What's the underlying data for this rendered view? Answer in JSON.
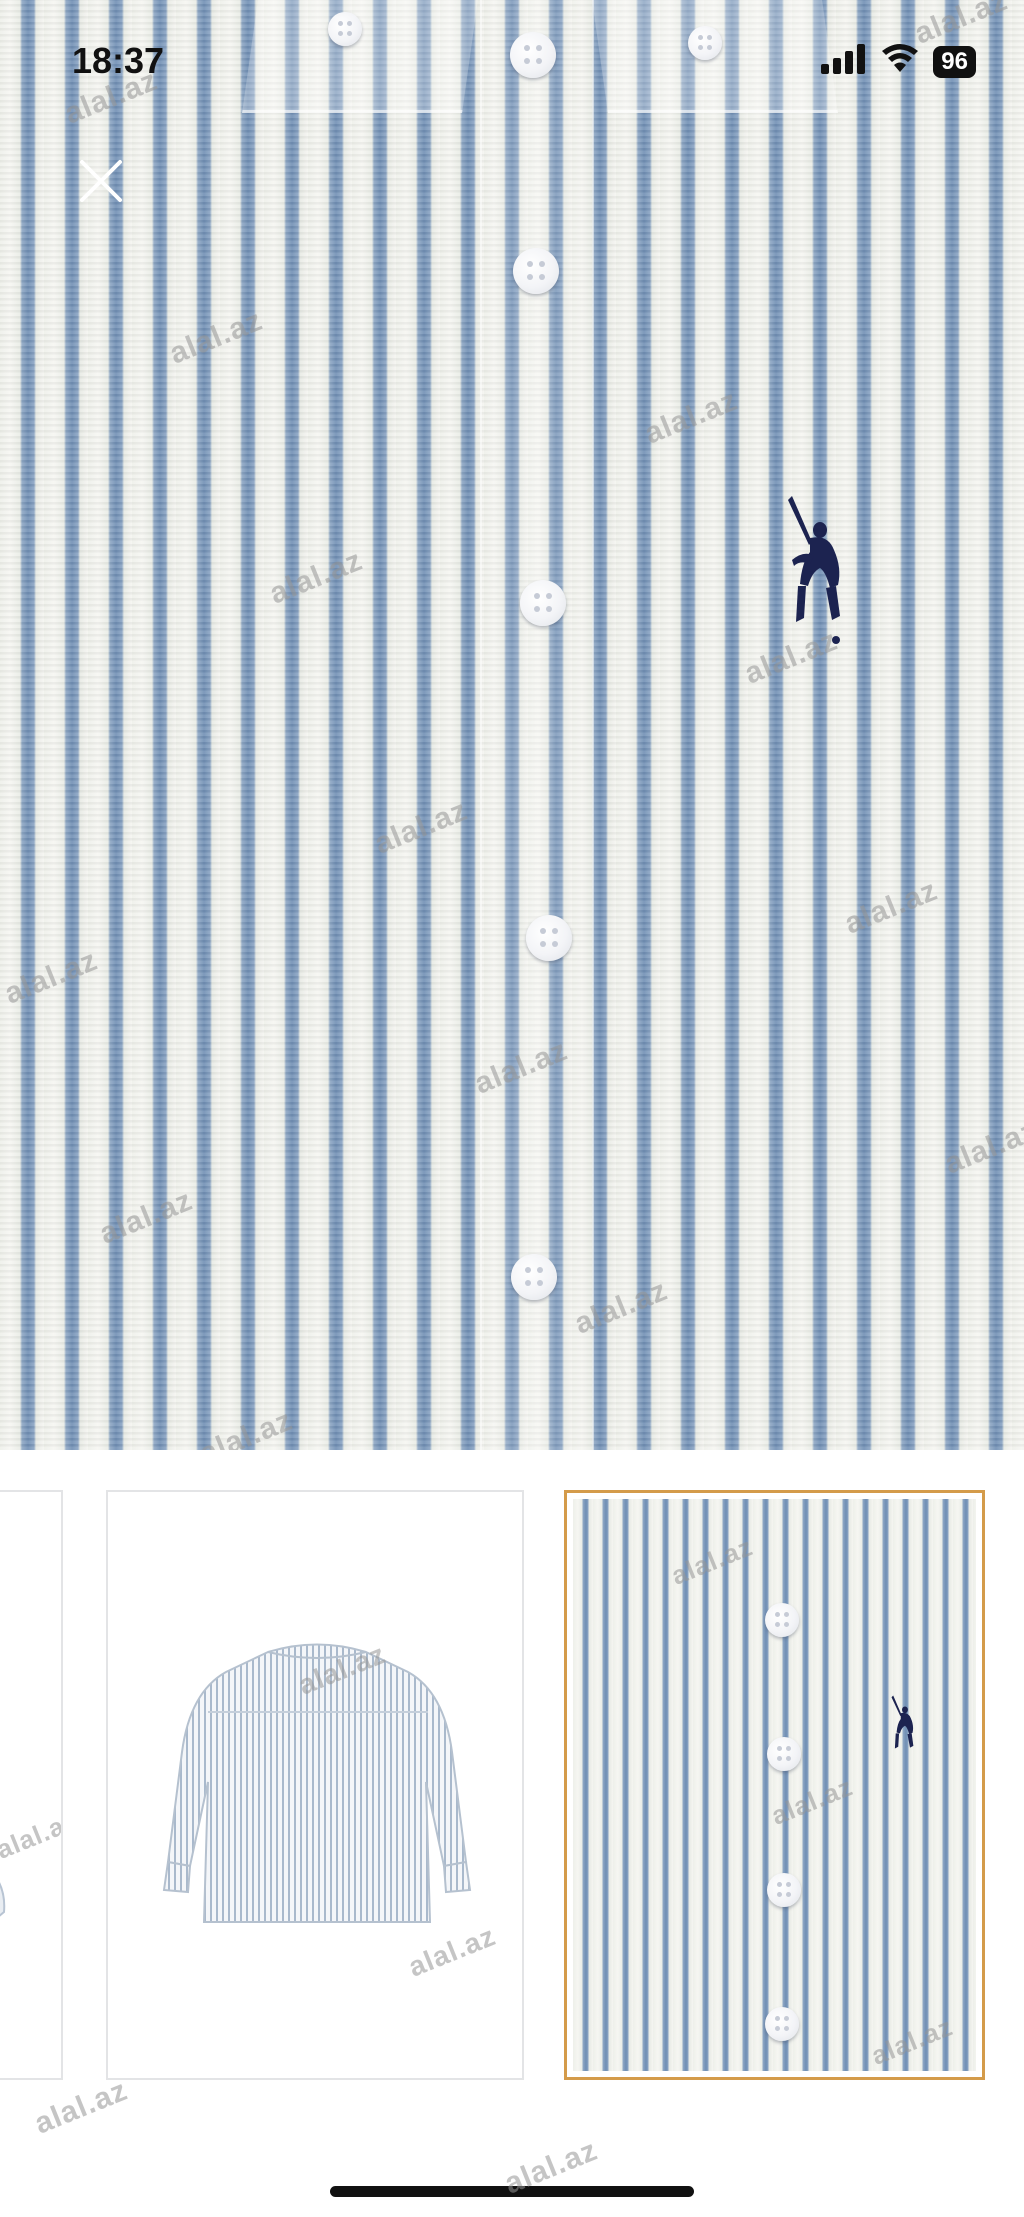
{
  "status_bar": {
    "time": "18:37",
    "battery": "96"
  },
  "viewer": {
    "close_icon": "close-icon",
    "watermark_text": "alal.az",
    "logo_icon": "polo-player-logo-icon"
  },
  "thumbnails": {
    "items": [
      {
        "name": "partial-view",
        "selected": false
      },
      {
        "name": "shirt-back-view",
        "selected": false
      },
      {
        "name": "fabric-closeup",
        "selected": true
      }
    ],
    "selected_border_color": "#d49b4a"
  },
  "colors": {
    "stripe_blue": "#6f8eb3",
    "fabric_white": "#f3f4f0",
    "logo_navy": "#1c2350"
  }
}
